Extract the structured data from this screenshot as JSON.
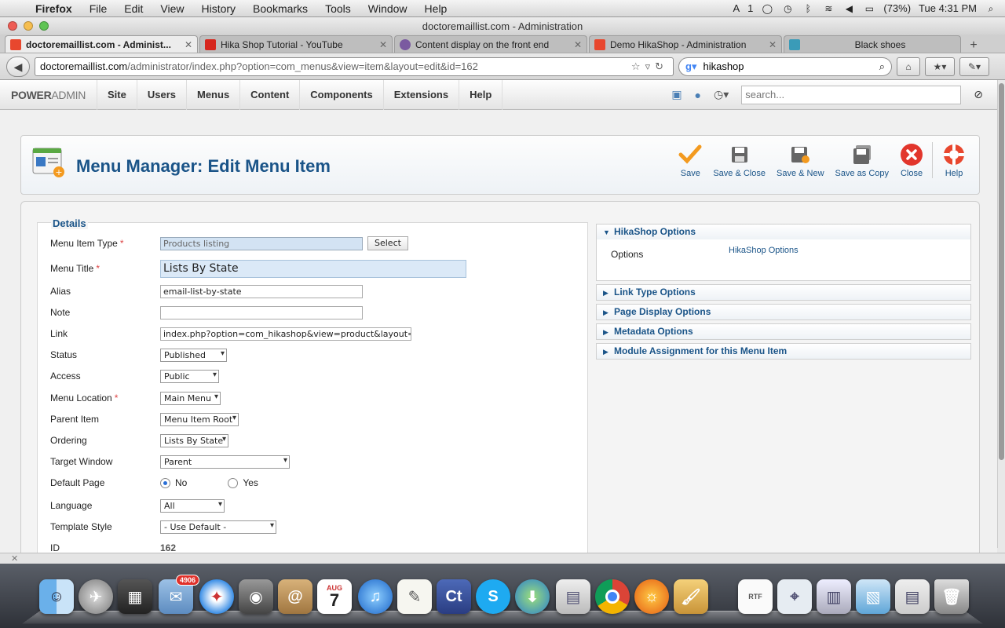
{
  "menubar": {
    "items": [
      "Firefox",
      "File",
      "Edit",
      "View",
      "History",
      "Bookmarks",
      "Tools",
      "Window",
      "Help"
    ],
    "battery": "(73%)",
    "clock": "Tue 4:31 PM",
    "badge": "1"
  },
  "window": {
    "title": "doctoremaillist.com - Administration"
  },
  "tabs": [
    {
      "label": "doctoremaillist.com - Administ...",
      "favicon_color": "#e8472e"
    },
    {
      "label": "Hika Shop Tutorial - YouTube",
      "favicon_color": "#d6261d"
    },
    {
      "label": "Content display on the front end",
      "favicon_color": "#7a5aa0"
    },
    {
      "label": "Demo HikaShop - Administration",
      "favicon_color": "#e8472e"
    },
    {
      "label": "Black shoes",
      "favicon_color": "#3a9bb8"
    }
  ],
  "navbar": {
    "url_domain": "doctoremaillist.com",
    "url_path": "/administrator/index.php?option=com_menus&view=item&layout=edit&id=162",
    "search_value": "hikashop"
  },
  "admin": {
    "logo_a": "POWER",
    "logo_b": "ADMIN",
    "menu": [
      "Site",
      "Users",
      "Menus",
      "Content",
      "Components",
      "Extensions",
      "Help"
    ],
    "search_placeholder": "search..."
  },
  "toolbar": {
    "title": "Menu Manager: Edit Menu Item",
    "buttons": [
      "Save",
      "Save & Close",
      "Save & New",
      "Save as Copy",
      "Close",
      "Help"
    ]
  },
  "details": {
    "legend": "Details",
    "fields": {
      "menu_item_type": {
        "label": "Menu Item Type",
        "value": "Products listing",
        "button": "Select"
      },
      "menu_title": {
        "label": "Menu Title",
        "value": "Lists By State"
      },
      "alias": {
        "label": "Alias",
        "value": "email-list-by-state"
      },
      "note": {
        "label": "Note",
        "value": ""
      },
      "link": {
        "label": "Link",
        "value": "index.php?option=com_hikashop&view=product&layout=listing"
      },
      "status": {
        "label": "Status",
        "value": "Published"
      },
      "access": {
        "label": "Access",
        "value": "Public"
      },
      "menu_location": {
        "label": "Menu Location",
        "value": "Main Menu"
      },
      "parent_item": {
        "label": "Parent Item",
        "value": "Menu Item Root"
      },
      "ordering": {
        "label": "Ordering",
        "value": "Lists By State"
      },
      "target_window": {
        "label": "Target Window",
        "value": "Parent"
      },
      "default_page": {
        "label": "Default Page",
        "options": [
          "No",
          "Yes"
        ],
        "selected": "No"
      },
      "language": {
        "label": "Language",
        "value": "All"
      },
      "template_style": {
        "label": "Template Style",
        "value": "- Use Default -"
      },
      "id": {
        "label": "ID",
        "value": "162"
      }
    }
  },
  "sidebar": {
    "hikashop_options": {
      "title": "HikaShop Options",
      "options_label": "Options",
      "options_value": "HikaShop Options"
    },
    "sections": [
      "Link Type Options",
      "Page Display Options",
      "Metadata Options",
      "Module Assignment for this Menu Item"
    ]
  },
  "dock": {
    "mail_badge": "4906",
    "calendar_month": "AUG",
    "calendar_day": "7"
  }
}
